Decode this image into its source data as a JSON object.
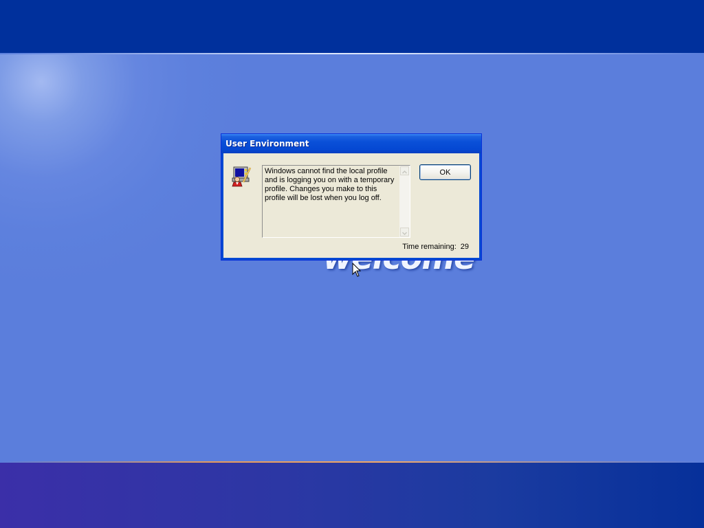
{
  "desktop": {
    "welcome_text": "welcome"
  },
  "dialog": {
    "title": "User Environment",
    "message": "Windows cannot find the local profile and is logging you on with a temporary profile. Changes you make to this profile will be lost when you log off.",
    "ok_label": "OK",
    "time_remaining_label": "Time remaining:",
    "time_remaining_value": "29",
    "icon": "user-profile-icon"
  },
  "colors": {
    "background": "#5a7edc",
    "top_bar": "#00309c",
    "title_bar": "#0548d2",
    "dialog_face": "#ece9d8"
  }
}
